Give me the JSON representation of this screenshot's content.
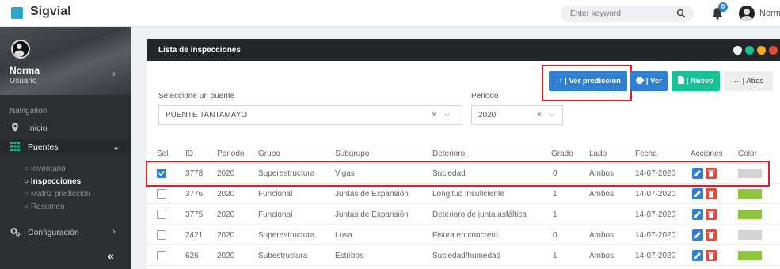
{
  "header": {
    "brand": "Sigvial",
    "search_placeholder": "Enter keyword",
    "notifications_count": "0",
    "user_name": "Norma"
  },
  "sidebar": {
    "user_name": "Norma",
    "user_role": "Usuario",
    "nav_header": "Navigation",
    "items": [
      {
        "label": "Inicio",
        "icon": "location-pin-icon"
      },
      {
        "label": "Puentes",
        "icon": "grid-icon",
        "expanded": true
      },
      {
        "label": "Configuración",
        "icon": "gears-icon"
      }
    ],
    "subitems": [
      "Inventario",
      "Inspecciones",
      "Matriz prediccion",
      "Resumen"
    ],
    "active_subitem": "Inspecciones",
    "collapse_label": "«"
  },
  "panel": {
    "title": "Lista de inspecciones",
    "bridge_label": "Seleccione un puente",
    "bridge_value": "PUENTE TANTAMAYO",
    "period_label": "Periodo",
    "period_value": "2020",
    "buttons": {
      "ver_prediccion": "↓↑ | Ver prediccion",
      "ver": "| Ver",
      "nuevo": "| Nuevo",
      "atras": "← | Atras"
    },
    "table": {
      "headers": [
        "Sel",
        "ID",
        "Periodo",
        "Grupo",
        "Subgrupo",
        "Deterioro",
        "Grado",
        "Lado",
        "Fecha",
        "Acciones",
        "Color"
      ],
      "rows": [
        {
          "sel": true,
          "id": "3778",
          "periodo": "2020",
          "grupo": "Superestructura",
          "subgrupo": "Vigas",
          "deterioro": "Suciedad",
          "grado": "0",
          "lado": "Ambos",
          "fecha": "14-07-2020",
          "color": "#d4d4d4"
        },
        {
          "sel": false,
          "id": "3776",
          "periodo": "2020",
          "grupo": "Funcional",
          "subgrupo": "Juntas de Expansión",
          "deterioro": "Longitud insuficiente",
          "grado": "1",
          "lado": "Ambos",
          "fecha": "14-07-2020",
          "color": "#8cc63f"
        },
        {
          "sel": false,
          "id": "3775",
          "periodo": "2020",
          "grupo": "Funcional",
          "subgrupo": "Juntas de Expansión",
          "deterioro": "Deterioro de junta asfáltica",
          "grado": "1",
          "lado": "",
          "fecha": "14-07-2020",
          "color": "#8cc63f"
        },
        {
          "sel": false,
          "id": "2421",
          "periodo": "2020",
          "grupo": "Superestructura",
          "subgrupo": "Losa",
          "deterioro": "Fisura en concreto",
          "grado": "0",
          "lado": "Ambos",
          "fecha": "14-07-2020",
          "color": "#d4d4d4"
        },
        {
          "sel": false,
          "id": "626",
          "periodo": "2020",
          "grupo": "Subestructura",
          "subgrupo": "Estribos",
          "deterioro": "Suciedad/humedad",
          "grado": "1",
          "lado": "Ambos",
          "fecha": "14-07-2020",
          "color": "#8cc63f"
        }
      ]
    }
  },
  "colors": {
    "accent_blue": "#2f80d1",
    "accent_green": "#19c196",
    "highlight_red": "#e31b23",
    "sidebar_bg": "#2d2f33"
  }
}
